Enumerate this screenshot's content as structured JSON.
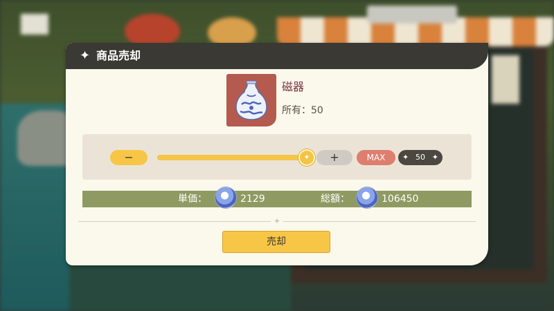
{
  "dialog": {
    "title": "商品売却",
    "title_icon": "sparkle-icon"
  },
  "item": {
    "name": "磁器",
    "owned_label": "所有：",
    "owned_count": "50",
    "icon": "porcelain-vase-icon"
  },
  "quantity": {
    "minus_label": "−",
    "plus_label": "+",
    "max_label": "MAX",
    "selected": "50",
    "slider_fraction": 1.0
  },
  "price": {
    "unit_label": "単価：",
    "unit_value": "2129",
    "total_label": "総額：",
    "total_value": "106450",
    "currency_icon": "shell-coin-icon"
  },
  "actions": {
    "sell_label": "売却"
  },
  "colors": {
    "title_bar": "#3a3934",
    "panel": "#fbf8ec",
    "accent_yellow": "#f7c646",
    "max_button": "#de7e6e",
    "price_bar": "#8e9a62"
  }
}
